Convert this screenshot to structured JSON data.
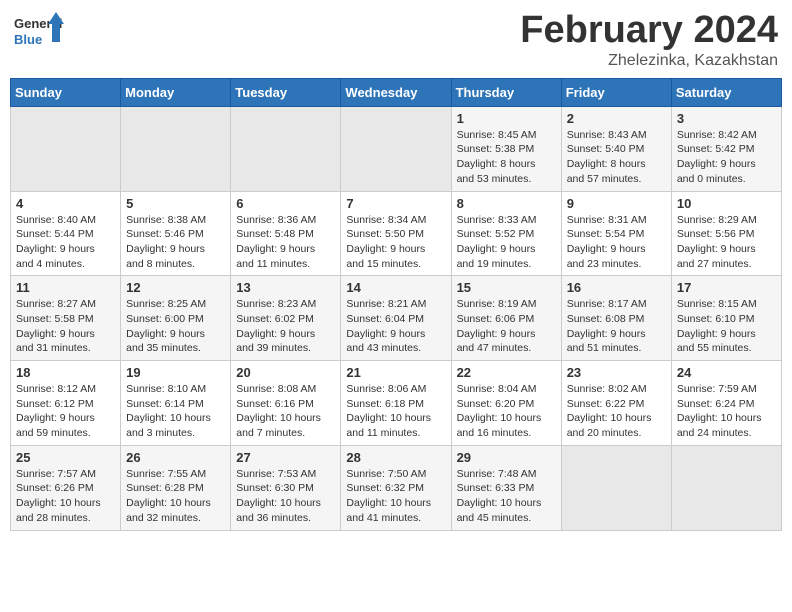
{
  "header": {
    "logo_line1": "General",
    "logo_line2": "Blue",
    "month": "February 2024",
    "location": "Zhelezinka, Kazakhstan"
  },
  "days_of_week": [
    "Sunday",
    "Monday",
    "Tuesday",
    "Wednesday",
    "Thursday",
    "Friday",
    "Saturday"
  ],
  "weeks": [
    [
      {
        "day": "",
        "info": ""
      },
      {
        "day": "",
        "info": ""
      },
      {
        "day": "",
        "info": ""
      },
      {
        "day": "",
        "info": ""
      },
      {
        "day": "1",
        "info": "Sunrise: 8:45 AM\nSunset: 5:38 PM\nDaylight: 8 hours\nand 53 minutes."
      },
      {
        "day": "2",
        "info": "Sunrise: 8:43 AM\nSunset: 5:40 PM\nDaylight: 8 hours\nand 57 minutes."
      },
      {
        "day": "3",
        "info": "Sunrise: 8:42 AM\nSunset: 5:42 PM\nDaylight: 9 hours\nand 0 minutes."
      }
    ],
    [
      {
        "day": "4",
        "info": "Sunrise: 8:40 AM\nSunset: 5:44 PM\nDaylight: 9 hours\nand 4 minutes."
      },
      {
        "day": "5",
        "info": "Sunrise: 8:38 AM\nSunset: 5:46 PM\nDaylight: 9 hours\nand 8 minutes."
      },
      {
        "day": "6",
        "info": "Sunrise: 8:36 AM\nSunset: 5:48 PM\nDaylight: 9 hours\nand 11 minutes."
      },
      {
        "day": "7",
        "info": "Sunrise: 8:34 AM\nSunset: 5:50 PM\nDaylight: 9 hours\nand 15 minutes."
      },
      {
        "day": "8",
        "info": "Sunrise: 8:33 AM\nSunset: 5:52 PM\nDaylight: 9 hours\nand 19 minutes."
      },
      {
        "day": "9",
        "info": "Sunrise: 8:31 AM\nSunset: 5:54 PM\nDaylight: 9 hours\nand 23 minutes."
      },
      {
        "day": "10",
        "info": "Sunrise: 8:29 AM\nSunset: 5:56 PM\nDaylight: 9 hours\nand 27 minutes."
      }
    ],
    [
      {
        "day": "11",
        "info": "Sunrise: 8:27 AM\nSunset: 5:58 PM\nDaylight: 9 hours\nand 31 minutes."
      },
      {
        "day": "12",
        "info": "Sunrise: 8:25 AM\nSunset: 6:00 PM\nDaylight: 9 hours\nand 35 minutes."
      },
      {
        "day": "13",
        "info": "Sunrise: 8:23 AM\nSunset: 6:02 PM\nDaylight: 9 hours\nand 39 minutes."
      },
      {
        "day": "14",
        "info": "Sunrise: 8:21 AM\nSunset: 6:04 PM\nDaylight: 9 hours\nand 43 minutes."
      },
      {
        "day": "15",
        "info": "Sunrise: 8:19 AM\nSunset: 6:06 PM\nDaylight: 9 hours\nand 47 minutes."
      },
      {
        "day": "16",
        "info": "Sunrise: 8:17 AM\nSunset: 6:08 PM\nDaylight: 9 hours\nand 51 minutes."
      },
      {
        "day": "17",
        "info": "Sunrise: 8:15 AM\nSunset: 6:10 PM\nDaylight: 9 hours\nand 55 minutes."
      }
    ],
    [
      {
        "day": "18",
        "info": "Sunrise: 8:12 AM\nSunset: 6:12 PM\nDaylight: 9 hours\nand 59 minutes."
      },
      {
        "day": "19",
        "info": "Sunrise: 8:10 AM\nSunset: 6:14 PM\nDaylight: 10 hours\nand 3 minutes."
      },
      {
        "day": "20",
        "info": "Sunrise: 8:08 AM\nSunset: 6:16 PM\nDaylight: 10 hours\nand 7 minutes."
      },
      {
        "day": "21",
        "info": "Sunrise: 8:06 AM\nSunset: 6:18 PM\nDaylight: 10 hours\nand 11 minutes."
      },
      {
        "day": "22",
        "info": "Sunrise: 8:04 AM\nSunset: 6:20 PM\nDaylight: 10 hours\nand 16 minutes."
      },
      {
        "day": "23",
        "info": "Sunrise: 8:02 AM\nSunset: 6:22 PM\nDaylight: 10 hours\nand 20 minutes."
      },
      {
        "day": "24",
        "info": "Sunrise: 7:59 AM\nSunset: 6:24 PM\nDaylight: 10 hours\nand 24 minutes."
      }
    ],
    [
      {
        "day": "25",
        "info": "Sunrise: 7:57 AM\nSunset: 6:26 PM\nDaylight: 10 hours\nand 28 minutes."
      },
      {
        "day": "26",
        "info": "Sunrise: 7:55 AM\nSunset: 6:28 PM\nDaylight: 10 hours\nand 32 minutes."
      },
      {
        "day": "27",
        "info": "Sunrise: 7:53 AM\nSunset: 6:30 PM\nDaylight: 10 hours\nand 36 minutes."
      },
      {
        "day": "28",
        "info": "Sunrise: 7:50 AM\nSunset: 6:32 PM\nDaylight: 10 hours\nand 41 minutes."
      },
      {
        "day": "29",
        "info": "Sunrise: 7:48 AM\nSunset: 6:33 PM\nDaylight: 10 hours\nand 45 minutes."
      },
      {
        "day": "",
        "info": ""
      },
      {
        "day": "",
        "info": ""
      }
    ]
  ]
}
